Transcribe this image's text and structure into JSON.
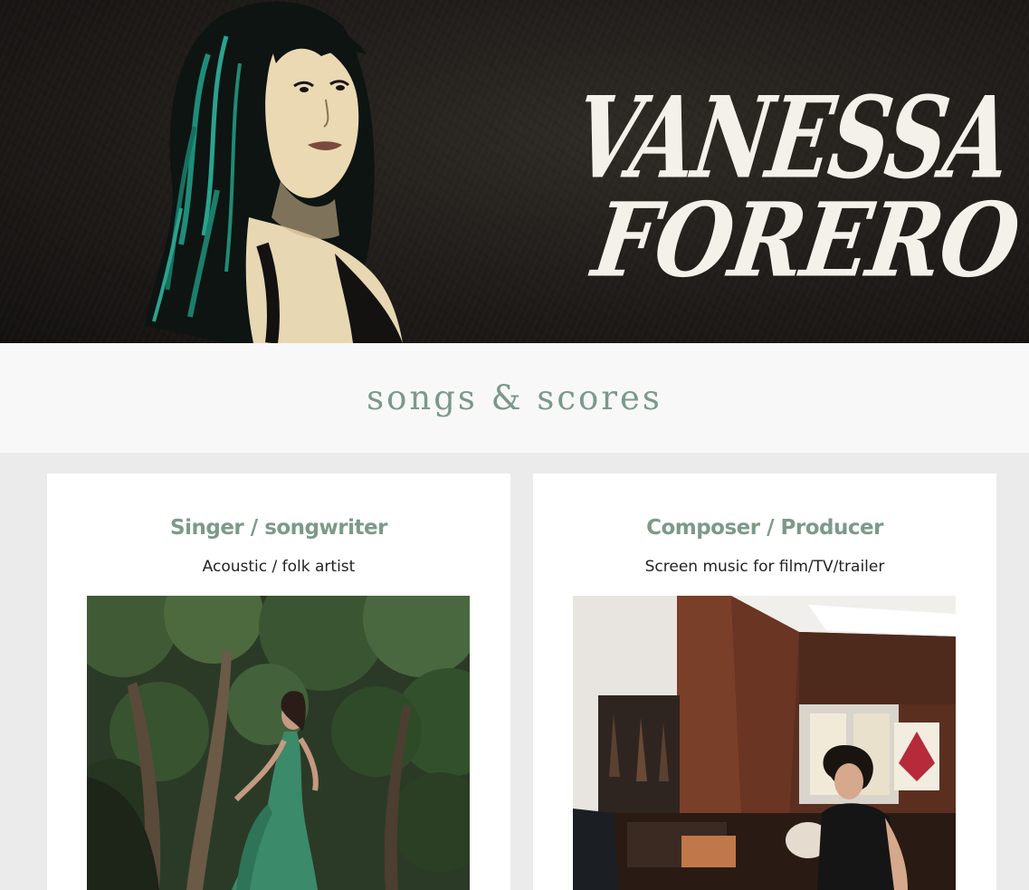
{
  "header": {
    "logo_line1": "VANESSA",
    "logo_line2": "FORERO"
  },
  "section": {
    "title": "songs & scores"
  },
  "cards": [
    {
      "heading": "Singer / songwriter",
      "subtitle": "Acoustic / folk artist"
    },
    {
      "heading": "Composer / Producer",
      "subtitle": "Screen music for film/TV/trailer"
    }
  ],
  "colors": {
    "accent_green": "#7a998a",
    "hero_bg": "#1f1c19",
    "page_bg": "#ebebeb"
  }
}
